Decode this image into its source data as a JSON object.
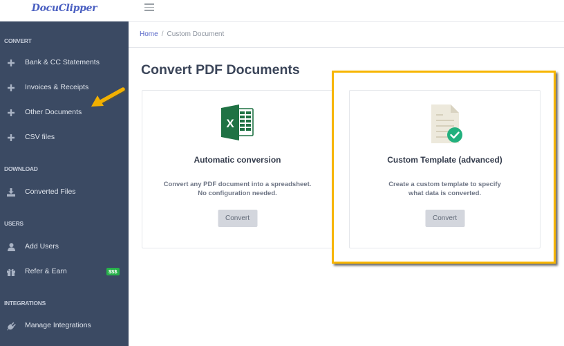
{
  "app": {
    "logo_text": "DocuClipper"
  },
  "topbar": {
    "menu_icon": "hamburger-icon"
  },
  "sidebar": {
    "sections": [
      {
        "label": "CONVERT",
        "items": [
          {
            "label": "Bank & CC Statements",
            "icon": "plus-icon"
          },
          {
            "label": "Invoices & Receipts",
            "icon": "plus-icon"
          },
          {
            "label": "Other Documents",
            "icon": "plus-icon"
          },
          {
            "label": "CSV files",
            "icon": "plus-icon"
          }
        ]
      },
      {
        "label": "DOWNLOAD",
        "items": [
          {
            "label": "Converted Files",
            "icon": "download-icon"
          }
        ]
      },
      {
        "label": "USERS",
        "items": [
          {
            "label": "Add Users",
            "icon": "user-icon"
          },
          {
            "label": "Refer & Earn",
            "icon": "gift-icon",
            "badge": "$$$"
          }
        ]
      },
      {
        "label": "INTEGRATIONS",
        "items": [
          {
            "label": "Manage Integrations",
            "icon": "plug-icon"
          }
        ]
      }
    ]
  },
  "breadcrumb": {
    "home": "Home",
    "separator": "/",
    "current": "Custom Document"
  },
  "main": {
    "title": "Convert PDF Documents",
    "cards": [
      {
        "icon": "excel-icon",
        "title": "Automatic conversion",
        "desc_line1": "Convert any PDF document into a spreadsheet.",
        "desc_line2": "No configuration needed.",
        "button": "Convert"
      },
      {
        "icon": "document-check-icon",
        "title": "Custom Template (advanced)",
        "desc_line1": "Create a custom template to specify",
        "desc_line2": "what data is converted.",
        "button": "Convert"
      }
    ]
  },
  "colors": {
    "sidebar_bg": "#3b4a63",
    "accent_link": "#5867c8",
    "highlight": "#f7b500",
    "badge": "#27b24a",
    "excel": "#1f7244",
    "check": "#22b07d"
  }
}
